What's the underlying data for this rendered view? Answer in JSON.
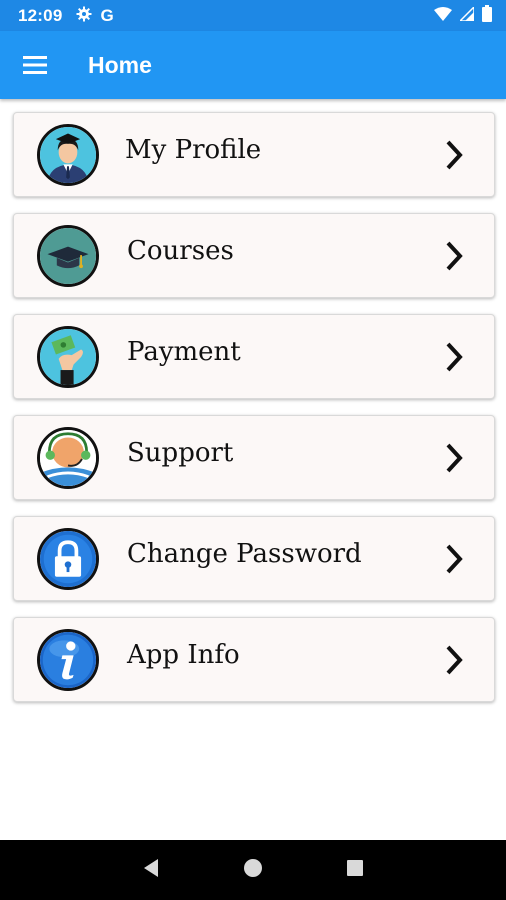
{
  "status_bar": {
    "time": "12:09",
    "icons": [
      "gear-icon",
      "google-g-icon",
      "wifi-icon",
      "signal-icon",
      "battery-icon"
    ],
    "google_letter": "G"
  },
  "app_bar": {
    "title": "Home",
    "menu_icon": "hamburger-menu-icon",
    "color": "#2196f3"
  },
  "menu": {
    "items": [
      {
        "label": "My Profile",
        "icon": "profile-icon"
      },
      {
        "label": "Courses",
        "icon": "graduation-cap-icon"
      },
      {
        "label": "Payment",
        "icon": "payment-hand-icon"
      },
      {
        "label": "Support",
        "icon": "support-headset-icon"
      },
      {
        "label": "Change Password",
        "icon": "padlock-icon"
      },
      {
        "label": "App Info",
        "icon": "info-icon"
      }
    ]
  },
  "nav_bar": {
    "icons": [
      "back-icon",
      "home-icon",
      "recents-icon"
    ]
  },
  "colors": {
    "status_bar": "#1e88e5",
    "card_background": "#fcf8f7"
  }
}
